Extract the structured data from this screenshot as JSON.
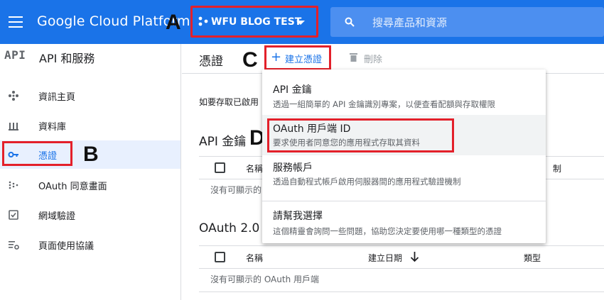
{
  "topbar": {
    "brand": "Google Cloud Platform",
    "project_name": "WFU BLOG TEST",
    "search_placeholder": "搜尋產品和資源"
  },
  "sidebar": {
    "logo_text": "API",
    "title": "API 和服務",
    "items": [
      {
        "label": "資訊主頁",
        "icon": "dashboard-icon"
      },
      {
        "label": "資料庫",
        "icon": "library-icon"
      },
      {
        "label": "憑證",
        "icon": "key-icon",
        "selected": true
      },
      {
        "label": "OAuth 同意畫面",
        "icon": "consent-icon"
      },
      {
        "label": "網域驗證",
        "icon": "checkbox-verify-icon"
      },
      {
        "label": "頁面使用協議",
        "icon": "settings-list-icon"
      }
    ]
  },
  "header": {
    "title": "憑證",
    "create_label": "建立憑證",
    "delete_label": "刪除"
  },
  "main": {
    "info_text": "如要存取已啟用",
    "api_keys": {
      "title": "API 金鑰",
      "col_name": "名稱",
      "col_restrictions": "制",
      "empty_text": "沒有可顯示的"
    },
    "oauth": {
      "title": "OAuth 2.0",
      "col_name": "名稱",
      "col_created": "建立日期",
      "col_type": "類型",
      "empty_text": "沒有可顯示的 OAuth 用戶端"
    }
  },
  "menu": {
    "items": [
      {
        "title": "API 金鑰",
        "desc": "透過一組簡單的 API 金鑰識別專案，以便查看配額與存取權限"
      },
      {
        "title": "OAuth 用戶端 ID",
        "desc": "要求使用者同意您的應用程式存取其資料"
      },
      {
        "title": "服務帳戶",
        "desc": "透過自動程式帳戶啟用伺服器間的應用程式驗證機制"
      },
      {
        "title": "請幫我選擇",
        "desc": "這個精靈會詢問一些問題，協助您決定要使用哪一種類型的憑證"
      }
    ]
  },
  "annotations": {
    "a": "A",
    "b": "B",
    "c": "C",
    "d": "D"
  },
  "colors": {
    "accent": "#1a73e8",
    "highlight": "#e3202a"
  }
}
